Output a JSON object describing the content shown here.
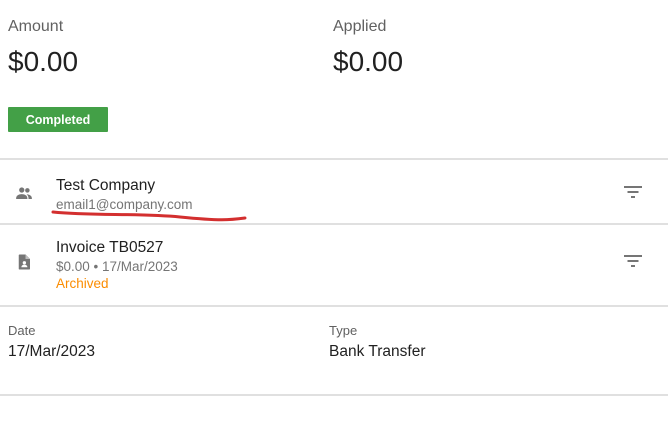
{
  "summary": {
    "amount_label": "Amount",
    "amount_value": "$0.00",
    "applied_label": "Applied",
    "applied_value": "$0.00",
    "status_badge": "Completed"
  },
  "contact": {
    "icon": "people-icon",
    "name": "Test Company",
    "email": "email1@company.com"
  },
  "invoice": {
    "icon": "document-icon",
    "title": "Invoice TB0527",
    "meta": "$0.00 • 17/Mar/2023",
    "status": "Archived"
  },
  "details": {
    "date_label": "Date",
    "date_value": "17/Mar/2023",
    "type_label": "Type",
    "type_value": "Bank Transfer"
  },
  "colors": {
    "badge_green": "#43a047",
    "archived_orange": "#fb8c00",
    "annotation_red": "#d32f2f",
    "divider": "#e0e0e0"
  }
}
